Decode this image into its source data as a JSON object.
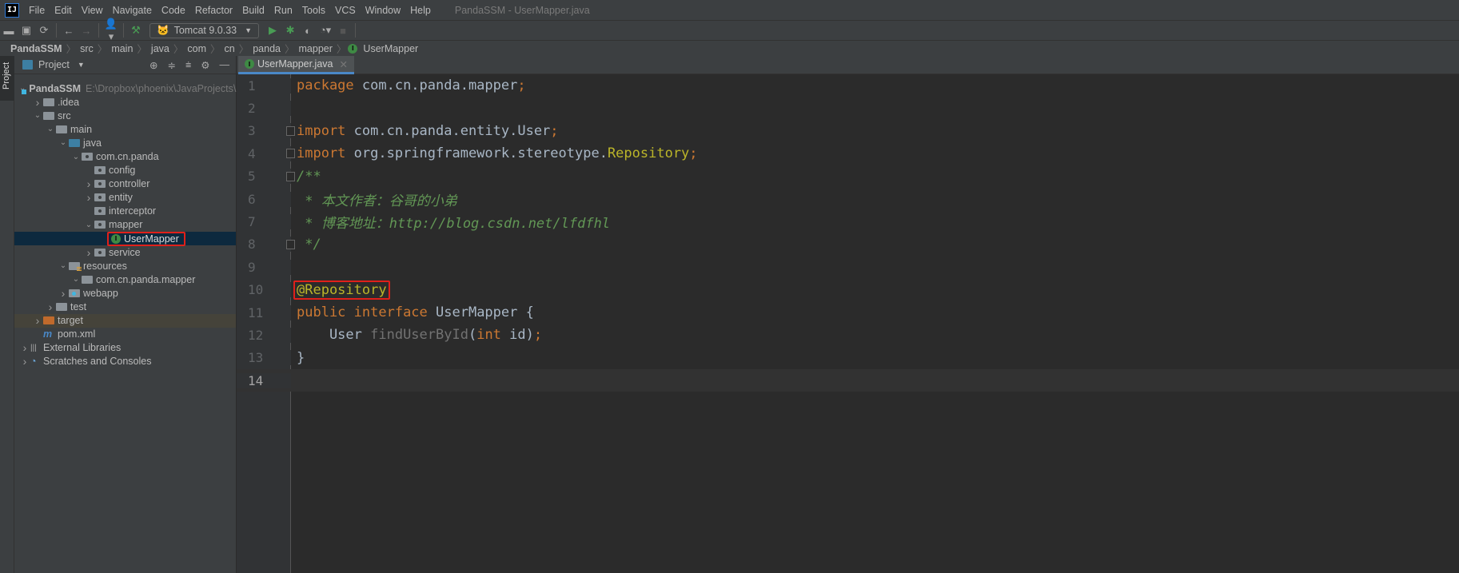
{
  "window_title": "PandaSSM - UserMapper.java",
  "menu": [
    "File",
    "Edit",
    "View",
    "Navigate",
    "Code",
    "Refactor",
    "Build",
    "Run",
    "Tools",
    "VCS",
    "Window",
    "Help"
  ],
  "toolbar": {
    "run_config": "Tomcat 9.0.33"
  },
  "breadcrumb": [
    "PandaSSM",
    "src",
    "main",
    "java",
    "com",
    "cn",
    "panda",
    "mapper",
    "UserMapper"
  ],
  "stripe": {
    "project_tab": "Project"
  },
  "project_panel": {
    "title": "Project",
    "root_path": "E:\\Dropbox\\phoenix\\JavaProjects\\Pa"
  },
  "tree": [
    {
      "label": "PandaSSM",
      "depth": 0,
      "arrow": "down",
      "icon": "mod",
      "bold": true
    },
    {
      "label": ".idea",
      "depth": 1,
      "arrow": "right",
      "icon": "plain"
    },
    {
      "label": "src",
      "depth": 1,
      "arrow": "down",
      "icon": "plain"
    },
    {
      "label": "main",
      "depth": 2,
      "arrow": "down",
      "icon": "plain"
    },
    {
      "label": "java",
      "depth": 3,
      "arrow": "down",
      "icon": "src"
    },
    {
      "label": "com.cn.panda",
      "depth": 4,
      "arrow": "down",
      "icon": "pkg"
    },
    {
      "label": "config",
      "depth": 5,
      "arrow": "",
      "icon": "pkg"
    },
    {
      "label": "controller",
      "depth": 5,
      "arrow": "right",
      "icon": "pkg"
    },
    {
      "label": "entity",
      "depth": 5,
      "arrow": "right",
      "icon": "pkg"
    },
    {
      "label": "interceptor",
      "depth": 5,
      "arrow": "",
      "icon": "pkg"
    },
    {
      "label": "mapper",
      "depth": 5,
      "arrow": "down",
      "icon": "pkg"
    },
    {
      "label": "UserMapper",
      "depth": 6,
      "arrow": "",
      "icon": "interface",
      "selected": true,
      "highlighted": true
    },
    {
      "label": "service",
      "depth": 5,
      "arrow": "right",
      "icon": "pkg"
    },
    {
      "label": "resources",
      "depth": 3,
      "arrow": "down",
      "icon": "res"
    },
    {
      "label": "com.cn.panda.mapper",
      "depth": 4,
      "arrow": "down",
      "icon": "plain"
    },
    {
      "label": "webapp",
      "depth": 3,
      "arrow": "right",
      "icon": "web"
    },
    {
      "label": "test",
      "depth": 2,
      "arrow": "right",
      "icon": "plain"
    },
    {
      "label": "target",
      "depth": 1,
      "arrow": "right",
      "icon": "exc",
      "excluded": true
    },
    {
      "label": "pom.xml",
      "depth": 1,
      "arrow": "",
      "icon": "maven"
    },
    {
      "label": "External Libraries",
      "depth": 0,
      "arrow": "right",
      "icon": "lib"
    },
    {
      "label": "Scratches and Consoles",
      "depth": 0,
      "arrow": "right",
      "icon": "scratch"
    }
  ],
  "editor": {
    "tab": "UserMapper.java",
    "current_line": 14,
    "lines": [
      [
        {
          "t": "package ",
          "c": "kw"
        },
        {
          "t": "com.cn.panda.mapper",
          "c": "pl"
        },
        {
          "t": ";",
          "c": "kw"
        }
      ],
      [],
      [
        {
          "t": "import ",
          "c": "kw"
        },
        {
          "t": "com.cn.panda.entity.User",
          "c": "pl"
        },
        {
          "t": ";",
          "c": "kw"
        }
      ],
      [
        {
          "t": "import ",
          "c": "kw"
        },
        {
          "t": "org.springframework.stereotype.",
          "c": "pl"
        },
        {
          "t": "Repository",
          "c": "ann"
        },
        {
          "t": ";",
          "c": "kw"
        }
      ],
      [
        {
          "t": "/**",
          "c": "cm"
        }
      ],
      [
        {
          "t": " * 本文作者：谷哥的小弟",
          "c": "cm"
        }
      ],
      [
        {
          "t": " * 博客地址：http://blog.csdn.net/lfdfhl",
          "c": "cm"
        }
      ],
      [
        {
          "t": " */",
          "c": "cm"
        }
      ],
      [],
      [
        {
          "t": "@Repository",
          "c": "ann",
          "box": true
        }
      ],
      [
        {
          "t": "public ",
          "c": "kw"
        },
        {
          "t": "interface ",
          "c": "kw"
        },
        {
          "t": "UserMapper {",
          "c": "pl"
        }
      ],
      [
        {
          "t": "    User ",
          "c": "pl"
        },
        {
          "t": "findUserById",
          "c": "fn"
        },
        {
          "t": "(",
          "c": "pl"
        },
        {
          "t": "int ",
          "c": "kw"
        },
        {
          "t": "id)",
          "c": "pl"
        },
        {
          "t": ";",
          "c": "kw"
        }
      ],
      [
        {
          "t": "}",
          "c": "pl"
        }
      ],
      []
    ],
    "fold_lines": [
      3,
      4,
      5,
      8
    ]
  }
}
